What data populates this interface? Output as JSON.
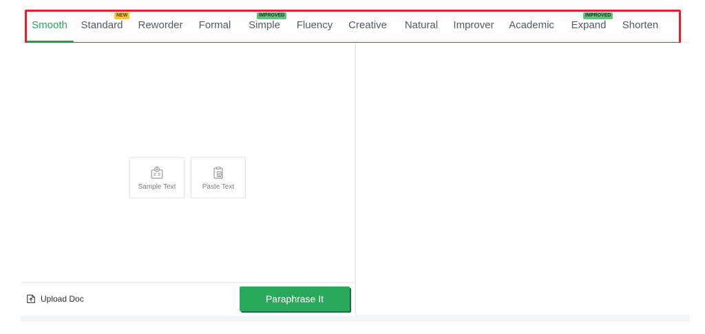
{
  "tabs": [
    {
      "label": "Smooth",
      "badge": ""
    },
    {
      "label": "Standard",
      "badge": "NEW"
    },
    {
      "label": "Reworder",
      "badge": ""
    },
    {
      "label": "Formal",
      "badge": ""
    },
    {
      "label": "Simple",
      "badge": "IMPROVED"
    },
    {
      "label": "Fluency",
      "badge": ""
    },
    {
      "label": "Creative",
      "badge": ""
    },
    {
      "label": "Natural",
      "badge": ""
    },
    {
      "label": "Improver",
      "badge": ""
    },
    {
      "label": "Academic",
      "badge": ""
    },
    {
      "label": "Expand",
      "badge": "IMPROVED"
    },
    {
      "label": "Shorten",
      "badge": ""
    }
  ],
  "active_tab": "Smooth",
  "input_actions": {
    "sample_label": "Sample Text",
    "paste_label": "Paste Text"
  },
  "bottom_bar": {
    "upload_label": "Upload Doc",
    "paraphrase_label": "Paraphrase It"
  },
  "colors": {
    "accent": "#22a559",
    "button": "#2aa85c",
    "new_badge": "#f8c23a",
    "improved_badge": "#64c17c",
    "highlight": "#e6202b"
  },
  "icons": {
    "sample": "document-add-icon",
    "paste": "clipboard-icon",
    "upload": "upload-icon"
  }
}
